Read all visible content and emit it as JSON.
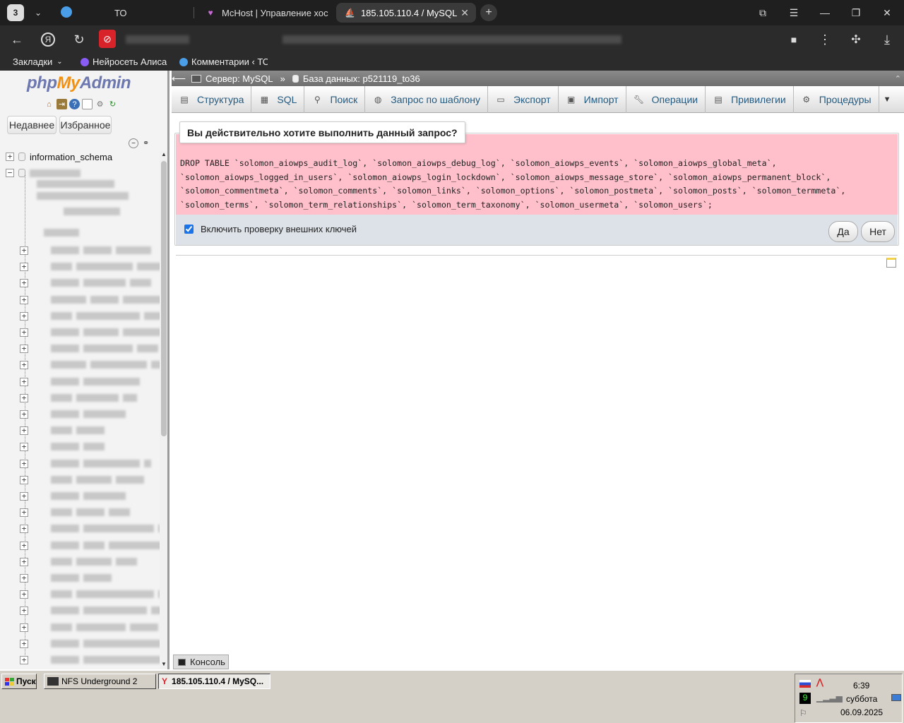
{
  "browser": {
    "tab_count": "3",
    "tabs": [
      {
        "label": "ТО"
      },
      {
        "label": "McHost | Управление хос"
      },
      {
        "label": "185.105.110.4 / MySQL"
      }
    ],
    "bookmarks": [
      {
        "label": "Закладки"
      },
      {
        "label": "Нейросеть Алиса"
      },
      {
        "label": "Комментарии ‹ ТО"
      }
    ]
  },
  "pma": {
    "logo": {
      "php": "php",
      "my": "My",
      "admin": "Admin"
    },
    "nav_tabs": [
      "Недавнее",
      "Избранное"
    ],
    "tree": {
      "first_db": "information_schema"
    },
    "breadcrumb": {
      "server": "Сервер: MySQL",
      "sep": "»",
      "database": "База данных: p521119_to36"
    },
    "menu": [
      "Структура",
      "SQL",
      "Поиск",
      "Запрос по шаблону",
      "Экспорт",
      "Импорт",
      "Операции",
      "Привилегии",
      "Процедуры"
    ],
    "confirm": {
      "question": "Вы действительно хотите выполнить данный запрос?",
      "sql_lines": [
        "DROP TABLE `solomon_aiowps_audit_log`, `solomon_aiowps_debug_log`, `solomon_aiowps_events`, `solomon_aiowps_global_meta`,",
        "`solomon_aiowps_logged_in_users`, `solomon_aiowps_login_lockdown`, `solomon_aiowps_message_store`, `solomon_aiowps_permanent_block`,",
        "`solomon_commentmeta`, `solomon_comments`, `solomon_links`, `solomon_options`, `solomon_postmeta`, `solomon_posts`, `solomon_termmeta`,",
        "`solomon_terms`, `solomon_term_relationships`, `solomon_term_taxonomy`, `solomon_usermeta`, `solomon_users`;"
      ],
      "fk_label": "Включить проверку внешних ключей",
      "fk_checked": true,
      "yes": "Да",
      "no": "Нет"
    },
    "console": "Консоль"
  },
  "taskbar": {
    "start": "Пуск",
    "items": [
      {
        "label": "NFS Underground 2"
      },
      {
        "label": "185.105.110.4 / MySQ..."
      }
    ],
    "tray": {
      "time": "6:39",
      "day": "суббота",
      "date": "06.09.2025",
      "num": "9"
    }
  }
}
